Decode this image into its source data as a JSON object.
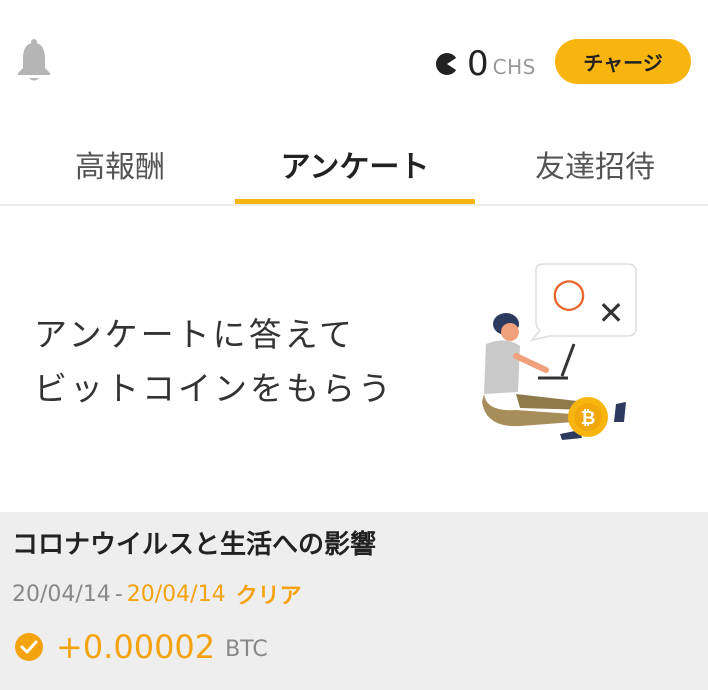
{
  "header": {
    "balance_value": "0",
    "balance_unit": "CHS",
    "charge_label": "チャージ"
  },
  "tabs": [
    {
      "label": "高報酬"
    },
    {
      "label": "アンケート"
    },
    {
      "label": "友達招待"
    }
  ],
  "banner": {
    "line1": "アンケートに答えて",
    "line2": "ビットコインをもらう",
    "illustration_symbols": {
      "circle": "○",
      "cross": "✕"
    }
  },
  "surveys": [
    {
      "title": "コロナウイルスと生活への影響",
      "date_start": "20/04/14",
      "date_sep": "-",
      "date_end": "20/04/14",
      "status": "クリア",
      "reward_value": "+0.00002",
      "reward_unit": "BTC"
    }
  ],
  "colors": {
    "accent": "#f9b50f",
    "accent_text": "#f5a20f",
    "card_bg": "#eeeeee",
    "muted": "#888888"
  },
  "icons": {
    "notification": "bell-icon",
    "balance": "coin-icon",
    "reward_status": "check-circle-icon"
  }
}
